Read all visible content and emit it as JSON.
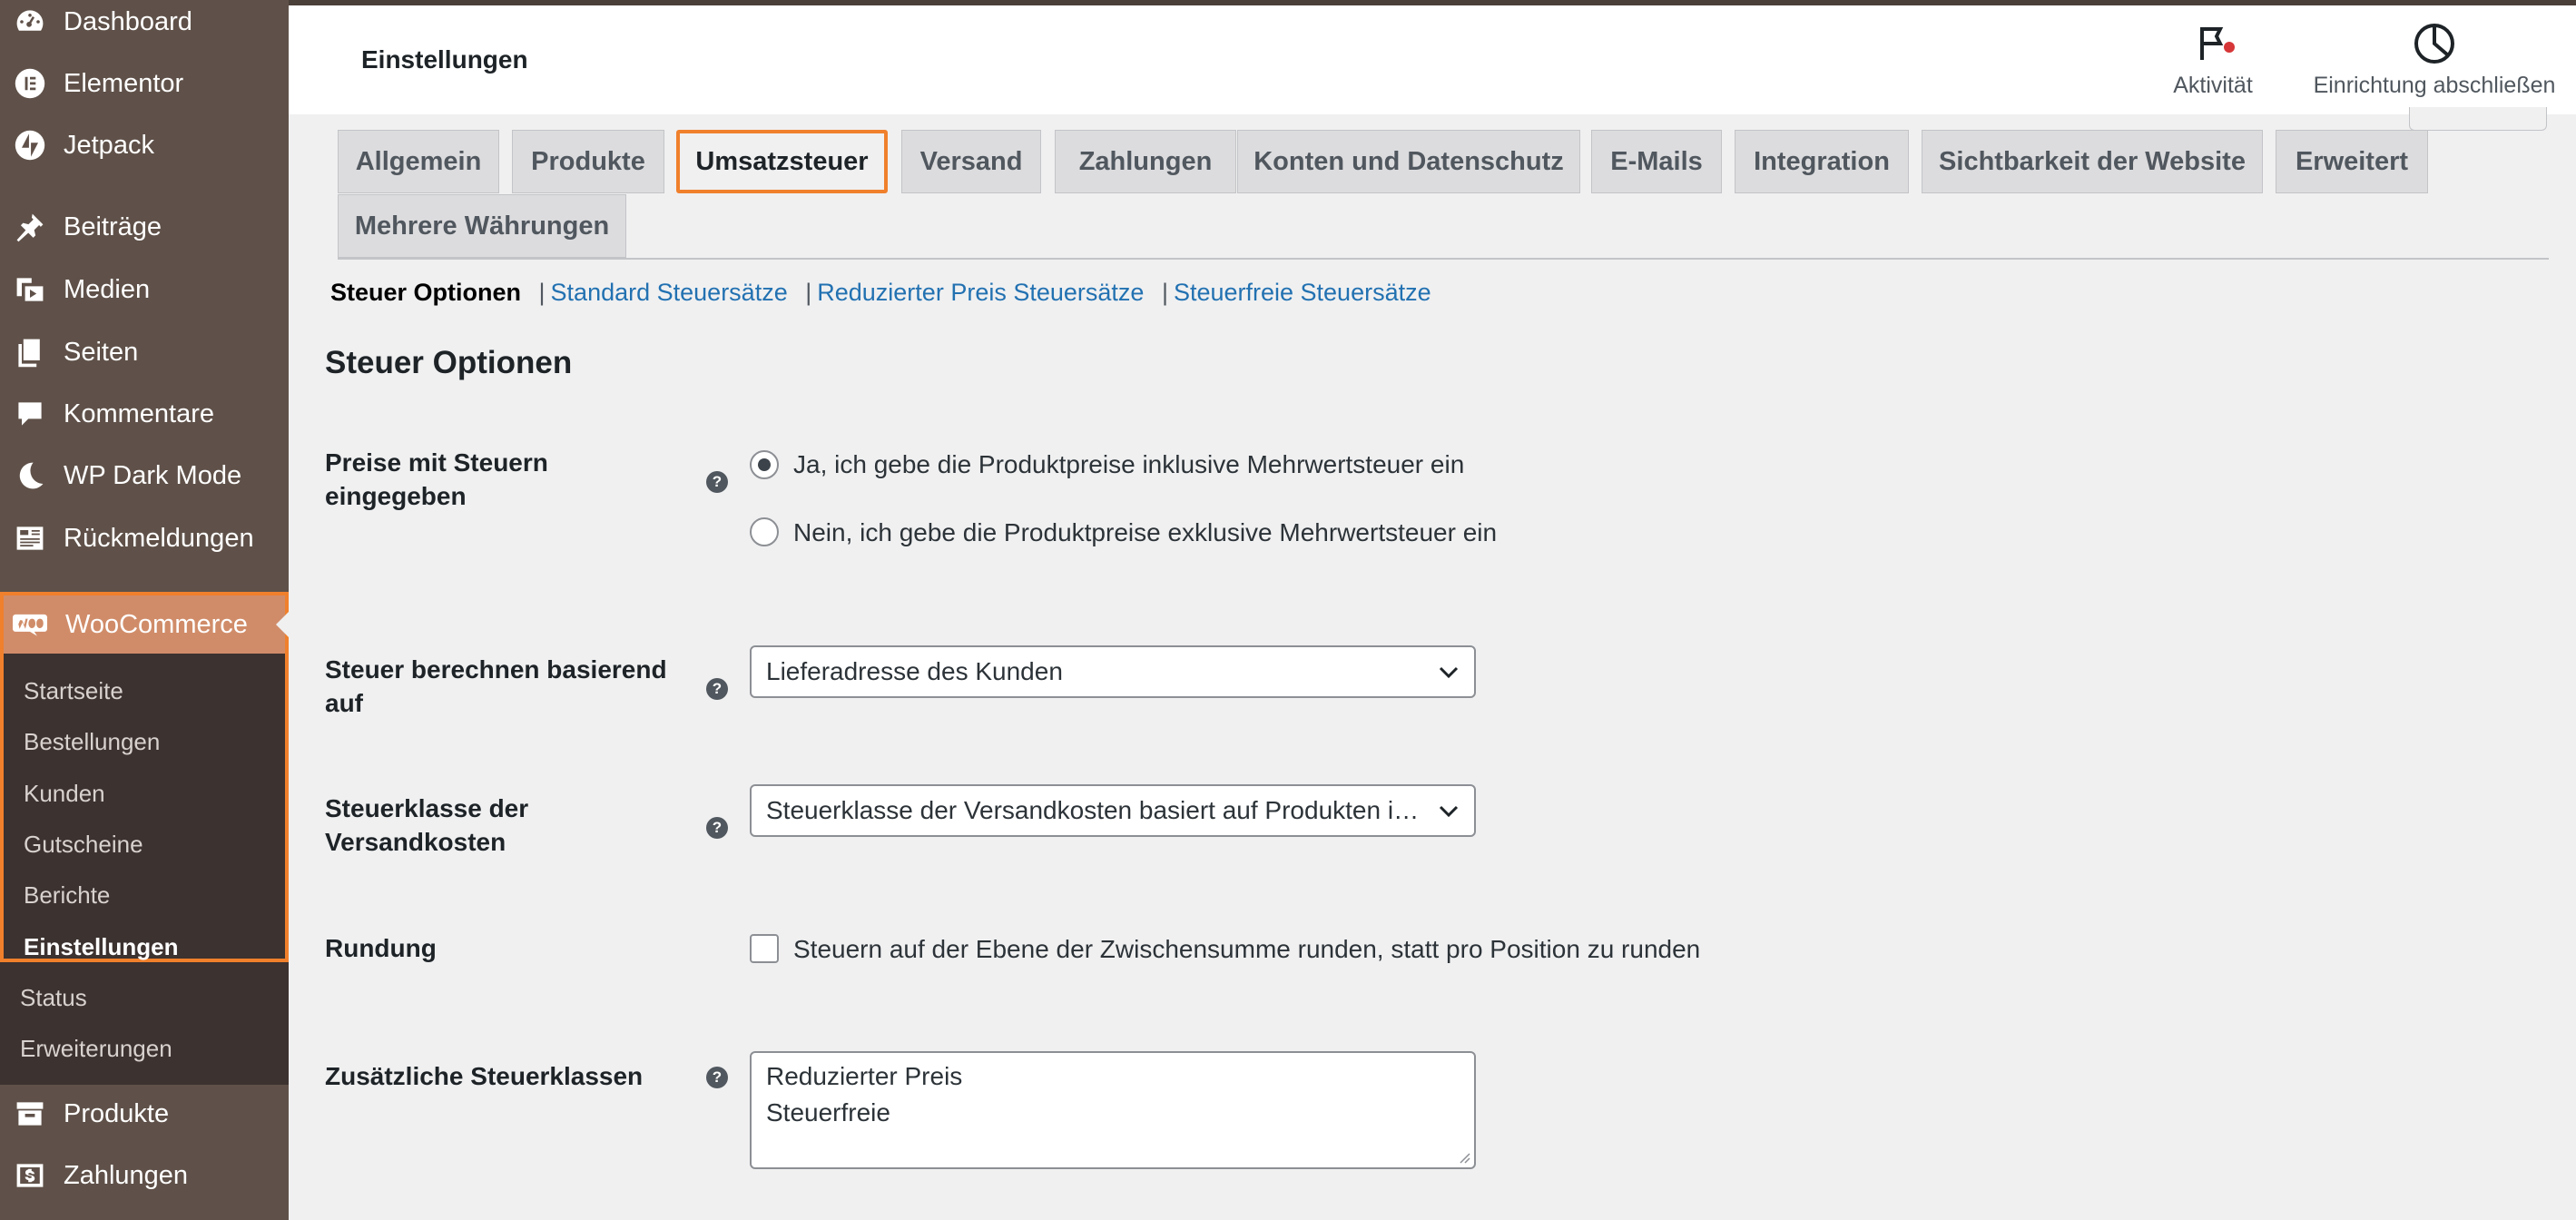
{
  "sidebar": {
    "menu": [
      {
        "label": "Dashboard",
        "icon": "dashboard-icon"
      },
      {
        "label": "Elementor",
        "icon": "elementor-icon"
      },
      {
        "label": "Jetpack",
        "icon": "jetpack-icon"
      },
      {
        "label": "Beiträge",
        "icon": "pin-icon"
      },
      {
        "label": "Medien",
        "icon": "media-icon"
      },
      {
        "label": "Seiten",
        "icon": "pages-icon"
      },
      {
        "label": "Kommentare",
        "icon": "comment-icon"
      },
      {
        "label": "WP Dark Mode",
        "icon": "moon-icon"
      },
      {
        "label": "Rückmeldungen",
        "icon": "feedback-icon"
      }
    ],
    "woocommerce": {
      "label": "WooCommerce",
      "icon": "woocommerce-icon",
      "submenu": [
        "Startseite",
        "Bestellungen",
        "Kunden",
        "Gutscheine",
        "Berichte",
        "Einstellungen",
        "Status",
        "Erweiterungen"
      ],
      "active_item": "Einstellungen"
    },
    "menu_after": [
      {
        "label": "Produkte",
        "icon": "archive-icon"
      },
      {
        "label": "Zahlungen",
        "icon": "payments-icon"
      }
    ],
    "colors": {
      "background": "#5f5149",
      "submenu_background": "#3c3230",
      "highlight": "#d08c69",
      "focus_border": "#f0802c"
    }
  },
  "header": {
    "title": "Einstellungen",
    "actions": [
      {
        "label": "Aktivität",
        "icon": "flag-icon"
      },
      {
        "label": "Einrichtung abschließen",
        "icon": "progress-circle-icon"
      }
    ]
  },
  "tabs": {
    "items": [
      "Allgemein",
      "Produkte",
      "Umsatzsteuer",
      "Versand",
      "Zahlungen",
      "Konten und Datenschutz",
      "E-Mails",
      "Integration",
      "Sichtbarkeit der Website",
      "Erweitert",
      "Mehrere Währungen"
    ],
    "active": "Umsatzsteuer"
  },
  "subsections": {
    "current": "Steuer Optionen",
    "links": [
      "Standard Steuersätze",
      "Reduzierter Preis Steuersätze",
      "Steuerfreie Steuersätze"
    ],
    "separator": "|"
  },
  "section_title": "Steuer Optionen",
  "form": {
    "prices_entered": {
      "label": "Preise mit Steuern eingegeben",
      "options": [
        {
          "label": "Ja, ich gebe die Produktpreise inklusive Mehrwertsteuer ein",
          "checked": true
        },
        {
          "label": "Nein, ich gebe die Produktpreise exklusive Mehrwertsteuer ein",
          "checked": false
        }
      ]
    },
    "calculate_based_on": {
      "label": "Steuer berechnen basierend auf",
      "value": "Lieferadresse des Kunden"
    },
    "shipping_tax_class": {
      "label": "Steuerklasse der Versandkosten",
      "value": "Steuerklasse der Versandkosten basiert auf Produkten im Warenkorb"
    },
    "rounding": {
      "label": "Rundung",
      "checkbox_label": "Steuern auf der Ebene der Zwischensumme runden, statt pro Position zu runden",
      "checked": false
    },
    "additional_classes": {
      "label": "Zusätzliche Steuerklassen",
      "lines": [
        "Reduzierter Preis",
        "Steuerfreie"
      ]
    },
    "help_glyph": "?"
  }
}
